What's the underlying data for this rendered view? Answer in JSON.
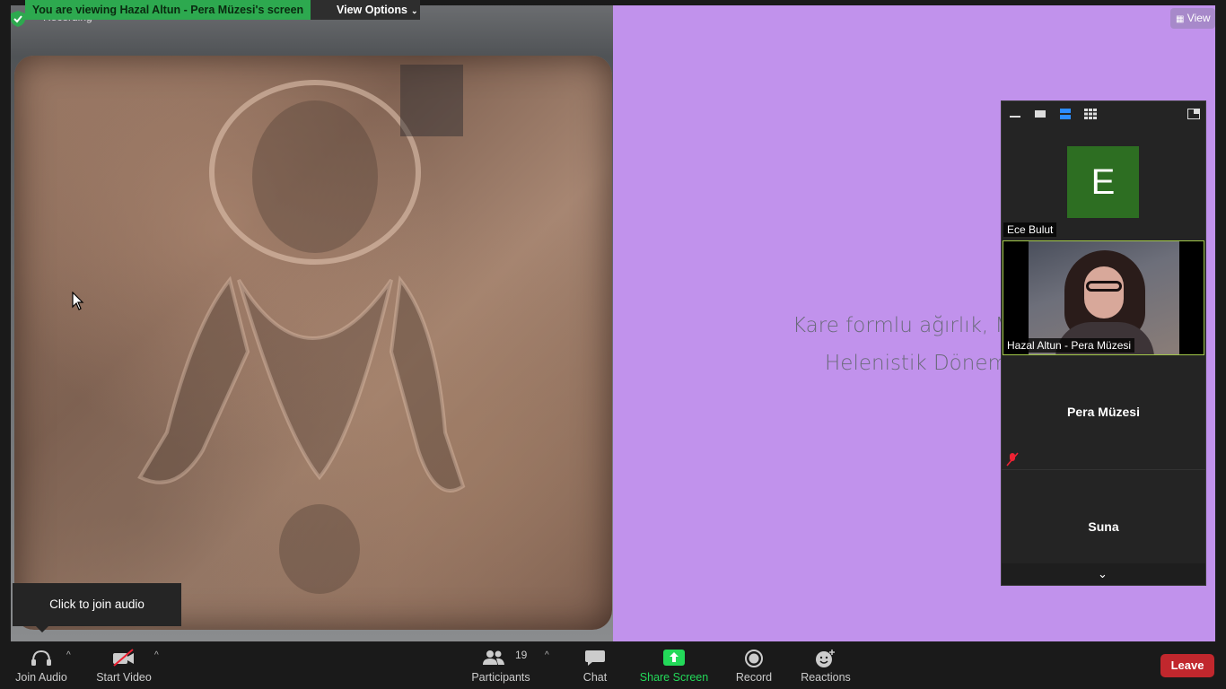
{
  "banner": {
    "text": "You are viewing Hazal Altun - Pera Müzesi's screen"
  },
  "recording": {
    "label": "Recording"
  },
  "view_options": {
    "label": "View Options"
  },
  "view_button": {
    "label": "View"
  },
  "slide": {
    "line1": "Kare formlu ağırlık, M",
    "line2": "Helenistik Dönem"
  },
  "join_audio_tip": {
    "text": "Click to join audio"
  },
  "participants_panel": {
    "tiles": [
      {
        "name": "Ece Bulut",
        "avatar_letter": "E"
      },
      {
        "name": "Hazal Altun - Pera Müzesi"
      },
      {
        "name": "Pera Müzesi"
      },
      {
        "name": "Suna"
      }
    ]
  },
  "toolbar": {
    "join_audio": "Join Audio",
    "start_video": "Start Video",
    "participants": "Participants",
    "participants_count": "19",
    "chat": "Chat",
    "share_screen": "Share Screen",
    "record": "Record",
    "reactions": "Reactions",
    "leave": "Leave"
  },
  "colors": {
    "banner_green": "#2da94f",
    "slide_bg": "#c192ec",
    "share_screen_green": "#23d959",
    "leave_red": "#c1272d",
    "avatar_green": "#2d6e22"
  }
}
